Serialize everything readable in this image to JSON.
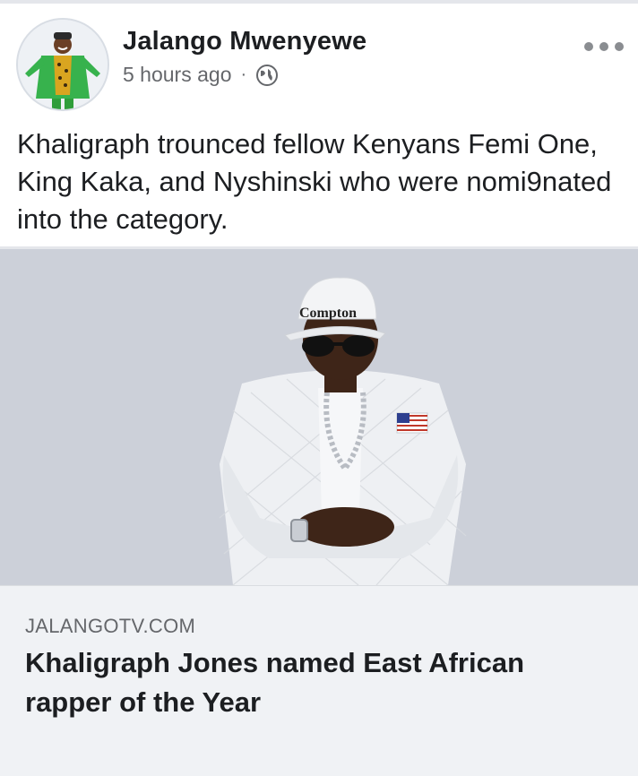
{
  "post": {
    "author": "Jalango Mwenyewe",
    "time": "5 hours ago",
    "separator": "·",
    "privacy_icon": "globe-icon",
    "body": "Khaligraph trounced fellow Kenyans Femi One, King Kaka, and Nyshinski who were nomi9nated into the category."
  },
  "photo": {
    "cap_text": "Compton"
  },
  "link": {
    "domain": "JALANGOTV.COM",
    "title": "Khaligraph Jones named East African rapper of the Year"
  },
  "colors": {
    "image_background": "#ccd0d9",
    "link_background": "#f0f2f5",
    "author_text": "#1c1e21",
    "muted_text": "#65676b"
  }
}
